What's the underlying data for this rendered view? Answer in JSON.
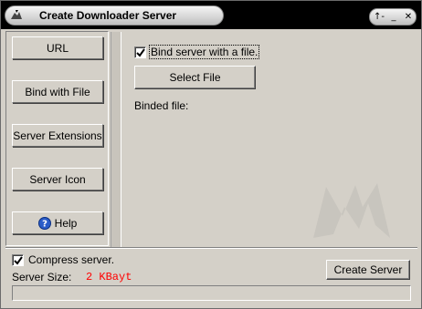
{
  "window": {
    "title": "Create Downloader Server",
    "controls": {
      "help": "↑-",
      "minimize": "_",
      "close": "✕"
    }
  },
  "sidebar": {
    "items": [
      {
        "label": "URL"
      },
      {
        "label": "Bind with File"
      },
      {
        "label": "Server Extensions"
      },
      {
        "label": "Server Icon"
      },
      {
        "label": "Help",
        "icon": "help-icon"
      }
    ]
  },
  "bind": {
    "checkbox_label": "Bind server with a file.",
    "checked": true,
    "select_button": "Select File",
    "binded_label": "Binded file:"
  },
  "footer": {
    "compress_label": "Compress server.",
    "compress_checked": true,
    "size_label": "Server Size:",
    "size_value": "2 KBayt",
    "create_button": "Create Server",
    "progress": 0
  },
  "colors": {
    "size_value": "#ff0000",
    "help_icon": "#2a5cc8"
  }
}
